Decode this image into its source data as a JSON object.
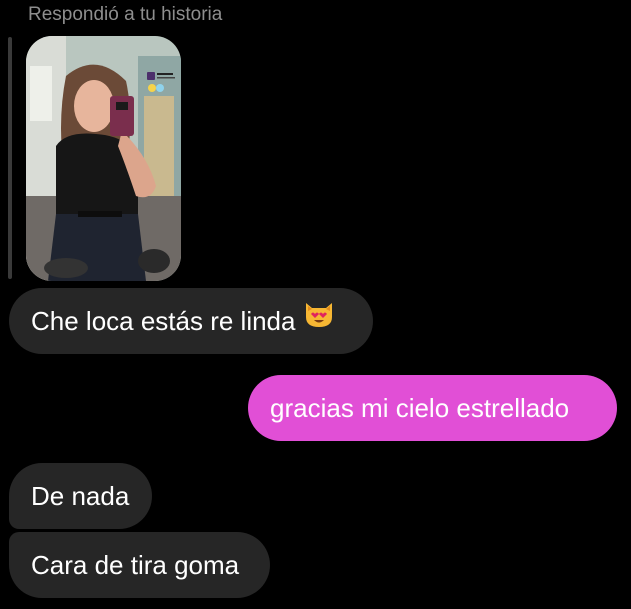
{
  "conversation": {
    "reply_caption": "Respondió a tu historia",
    "messages": [
      {
        "direction": "incoming",
        "text": "Che loca estás re linda",
        "emoji": "smiling-cat-heart-eyes"
      },
      {
        "direction": "outgoing",
        "text": "gracias mi cielo estrellado"
      },
      {
        "direction": "incoming",
        "text": "De nada"
      },
      {
        "direction": "incoming",
        "text": "Cara de tira goma"
      }
    ]
  },
  "colors": {
    "background": "#000000",
    "incoming_bubble": "#262626",
    "outgoing_bubble": "#e14fd6",
    "caption_text": "#8e8e8e",
    "message_text": "#ffffff"
  }
}
